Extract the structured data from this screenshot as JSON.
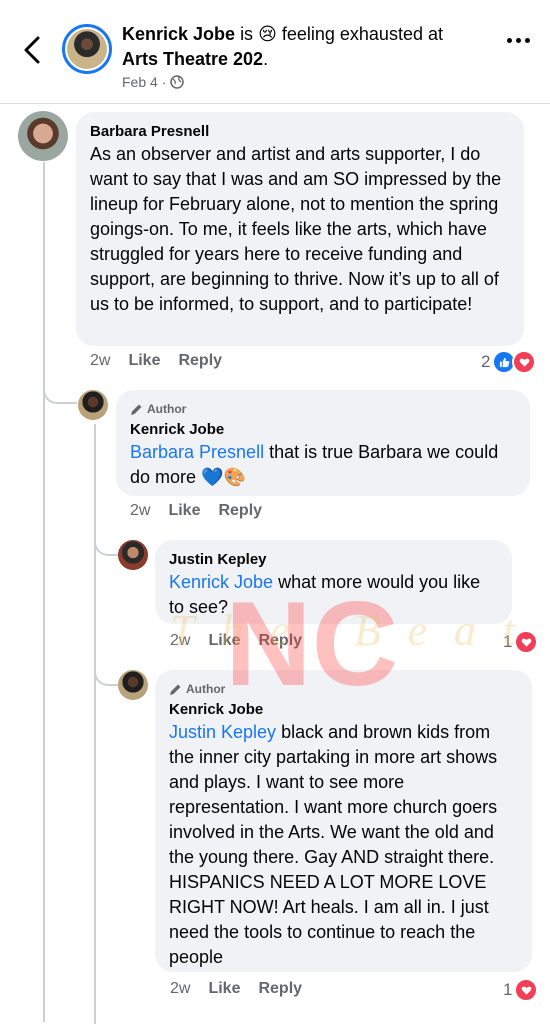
{
  "header": {
    "author": "Kenrick Jobe",
    "is_word": "is",
    "feeling_emoji": "😢",
    "feeling_text": "feeling exhausted at",
    "place": "Arts Theatre 202",
    "place_suffix": ".",
    "date": "Feb 4",
    "separator": "·",
    "privacy_icon": "globe-icon"
  },
  "comments": [
    {
      "name": "Barbara Presnell",
      "text": "As an observer and artist and arts supporter, I do want to say that I was and am SO impressed by the lineup for February alone, not to mention the spring goings-on. To me, it feels like the arts, which have struggled for years here to receive funding and support, are beginning to thrive. Now it’s up to all of us to be informed, to support, and to participate!",
      "time": "2w",
      "like_label": "Like",
      "reply_label": "Reply",
      "reaction_count": "2"
    },
    {
      "badge": "Author",
      "name": "Kenrick Jobe",
      "mention": "Barbara Presnell",
      "text": " that is true Barbara we could do more 💙🎨",
      "time": "2w",
      "like_label": "Like",
      "reply_label": "Reply"
    },
    {
      "name": "Justin Kepley",
      "mention": "Kenrick Jobe",
      "text": " what more would you like to see?",
      "time": "2w",
      "like_label": "Like",
      "reply_label": "Reply",
      "reaction_count": "1"
    },
    {
      "badge": "Author",
      "name": "Kenrick Jobe",
      "mention": "Justin Kepley",
      "text": " black and brown kids from the inner city partaking in more art shows and plays. I want to see more representation. I want more church goers involved in the Arts. We want the old and the young there. Gay AND straight there. HISPANICS NEED A LOT MORE LOVE RIGHT NOW! Art heals. I am all in. I just need the tools to continue to reach the people",
      "time": "2w",
      "like_label": "Like",
      "reply_label": "Reply",
      "reaction_count": "1"
    }
  ],
  "watermark": {
    "big": "NC",
    "script": "The Beat"
  },
  "colors": {
    "link": "#1877f2",
    "like": "#1877f2",
    "love": "#f33e58",
    "bubble": "#f0f2f5",
    "muted": "#65676b"
  }
}
